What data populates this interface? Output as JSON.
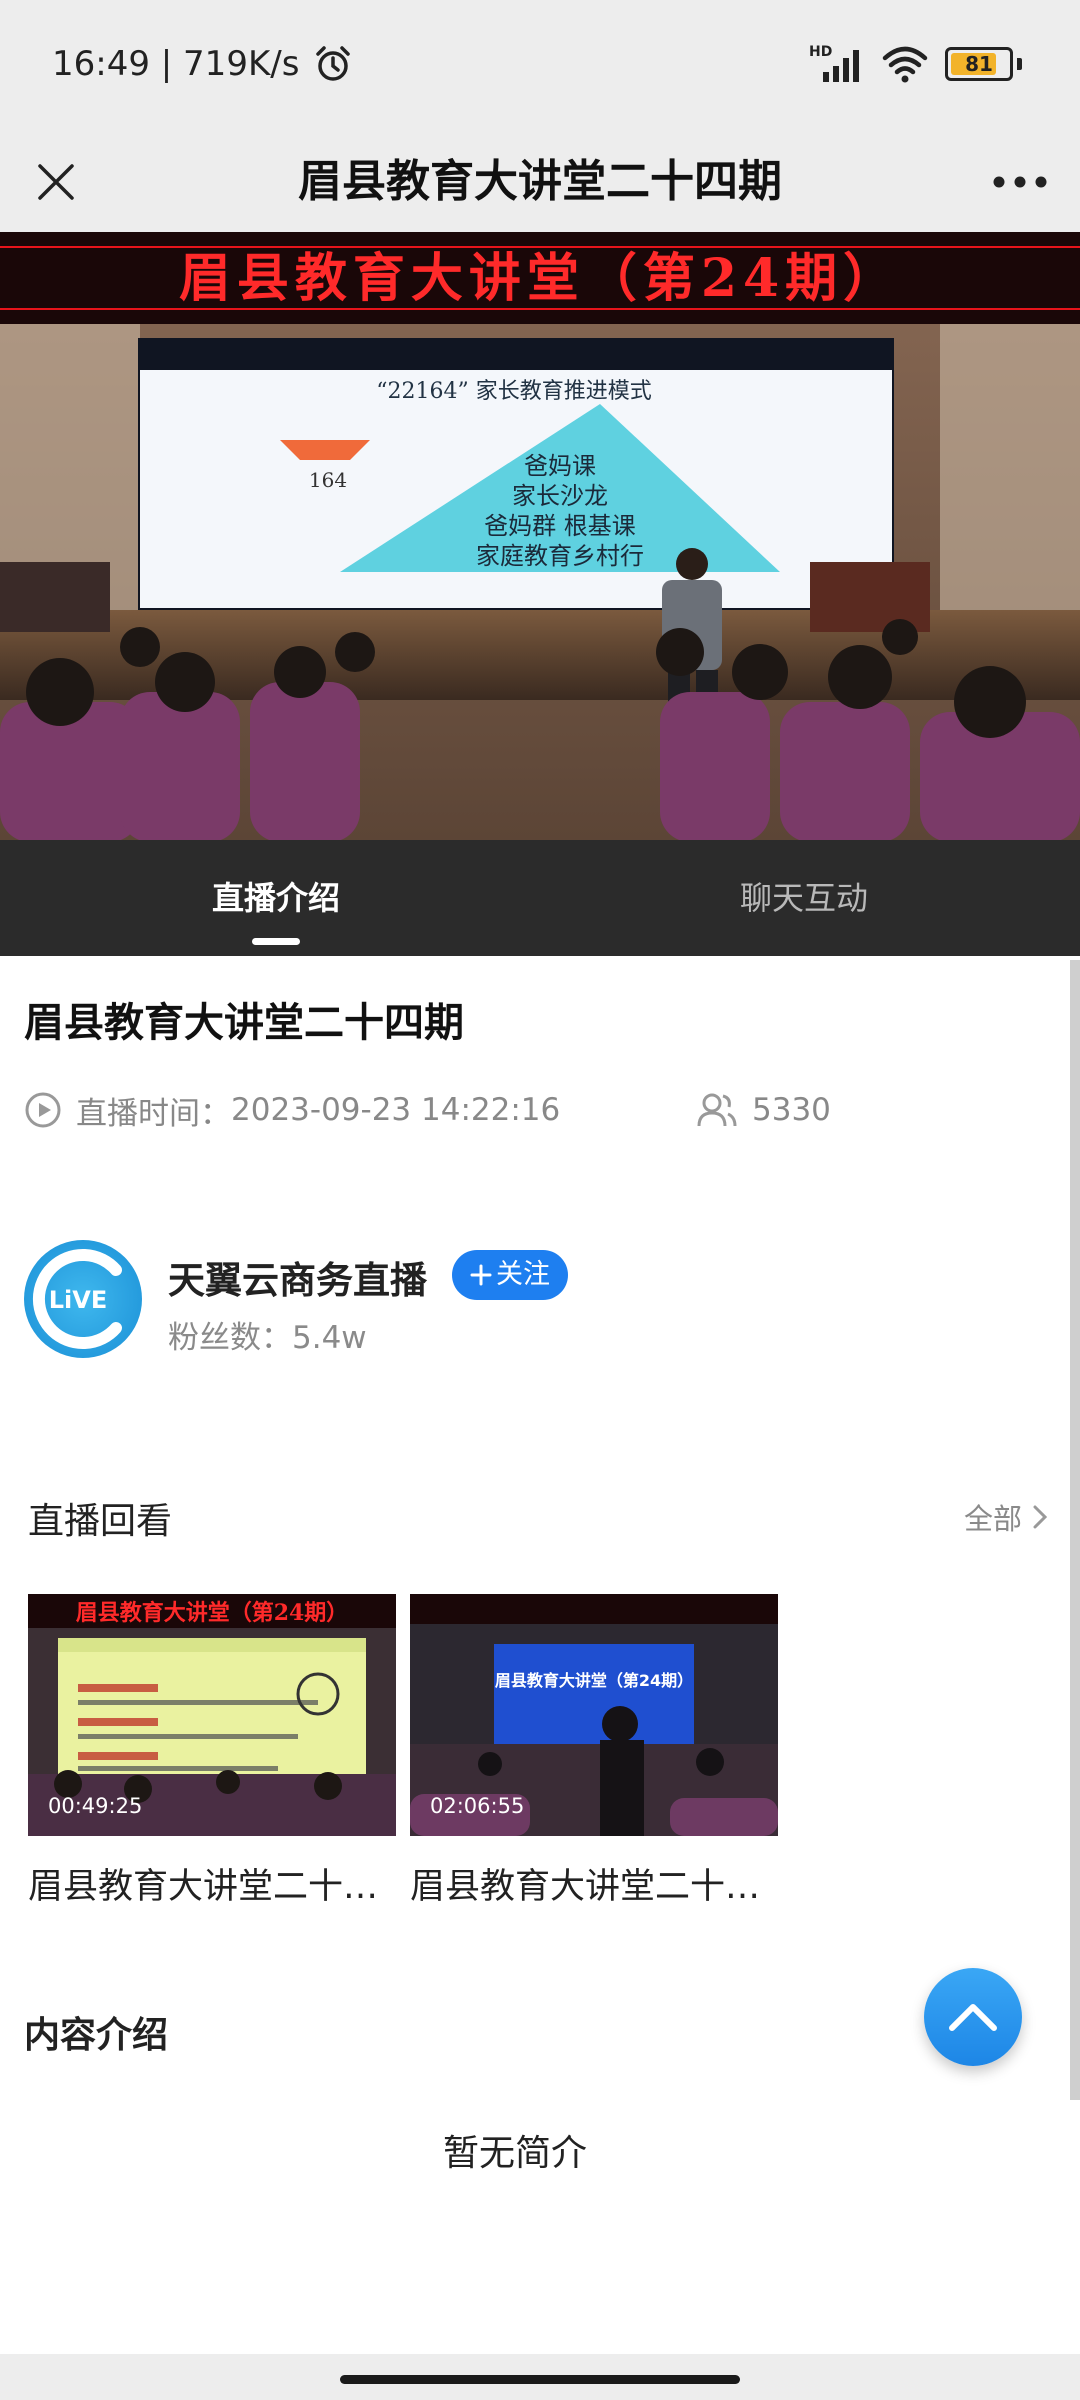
{
  "status_bar": {
    "time_speed": "16:49 | 719K/s",
    "hd_label": "HD",
    "battery_level": 81,
    "battery_label": "81"
  },
  "nav": {
    "title": "眉县教育大讲堂二十四期",
    "close_icon": "close-icon",
    "more_icon": "more-icon"
  },
  "video": {
    "banner_text": "眉县教育大讲堂（第24期）",
    "slide_heading": "“22164” 家长教育推进模式",
    "slide_lines": [
      "爸妈课",
      "家长沙龙",
      "爸妈群  根基课",
      "家庭教育乡村行"
    ],
    "slide_side": "164"
  },
  "tabs": {
    "intro": "直播介绍",
    "chat": "聊天互动"
  },
  "live": {
    "title": "眉县教育大讲堂二十四期",
    "time_label": "直播时间：",
    "time_value": "2023-09-23 14:22:16",
    "viewers": "5330"
  },
  "channel": {
    "avatar_text": "LiVE",
    "name": "天翼云商务直播",
    "follow_label": "关注",
    "fans_label": "粉丝数：",
    "fans_value": "5.4w"
  },
  "replay": {
    "section_title": "直播回看",
    "see_all": "全部",
    "items": [
      {
        "duration": "00:49:25",
        "title": "眉县教育大讲堂二十四期",
        "banner": "眉县教育大讲堂（第24期）"
      },
      {
        "duration": "02:06:55",
        "title": "眉县教育大讲堂二十四期",
        "banner": "眉县教育大讲堂（第24期）"
      }
    ]
  },
  "intro": {
    "section_title": "内容介绍",
    "empty_text": "暂无简介"
  },
  "colors": {
    "accent": "#1e7ff0",
    "tab_bar": "#2b2b2b",
    "banner_red": "#e8141b",
    "battery": "#f2b32a"
  }
}
